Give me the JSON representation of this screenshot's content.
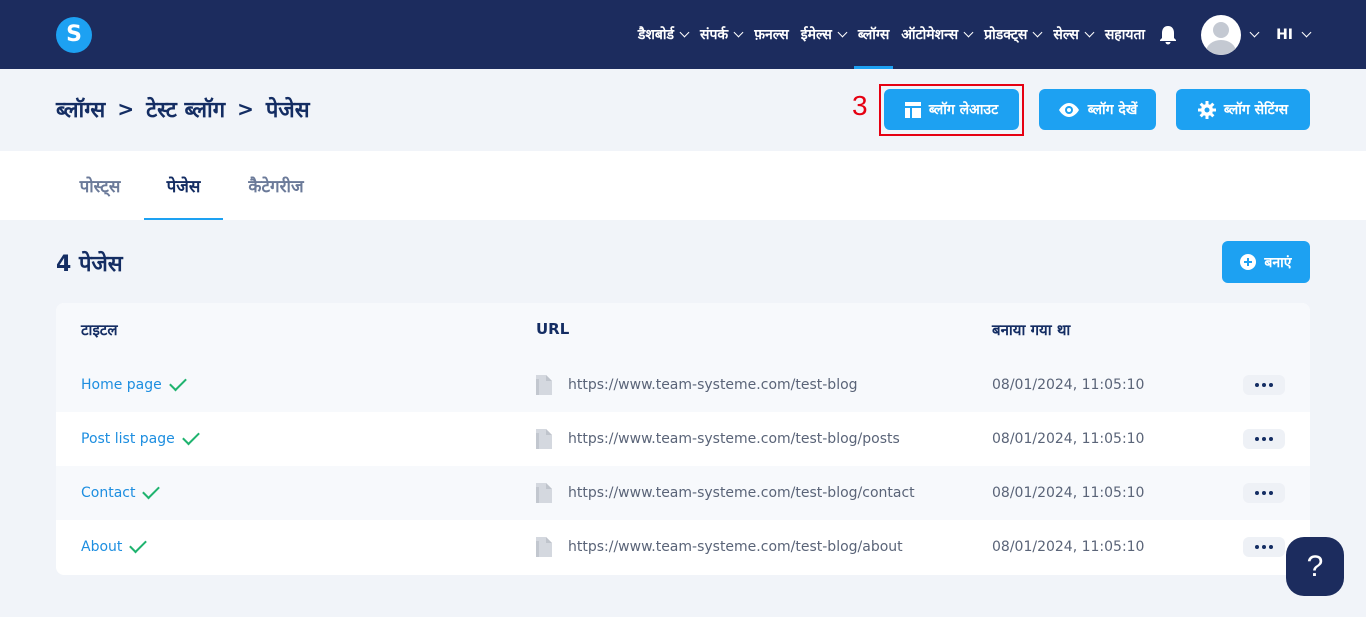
{
  "logo": {
    "letter": "S"
  },
  "nav": {
    "items": [
      {
        "label": "डैशबोर्ड",
        "dropdown": true
      },
      {
        "label": "संपर्क",
        "dropdown": true
      },
      {
        "label": "फ़नल्स",
        "dropdown": false
      },
      {
        "label": "ईमेल्स",
        "dropdown": true
      },
      {
        "label": "ब्लॉग्स",
        "dropdown": false,
        "active": true
      },
      {
        "label": "ऑटोमेशन्स",
        "dropdown": true
      },
      {
        "label": "प्रोडक्ट्स",
        "dropdown": true
      },
      {
        "label": "सेल्स",
        "dropdown": true
      },
      {
        "label": "सहायता",
        "dropdown": false
      }
    ],
    "language": "HI"
  },
  "breadcrumb": {
    "items": [
      "ब्लॉग्स",
      "टेस्ट ब्लॉग",
      "पेजेस"
    ],
    "separator": ">"
  },
  "header_buttons": {
    "layout": "ब्लॉग लेआउट",
    "view": "ब्लॉग देखें",
    "settings": "ब्लॉग सेटिंग्स"
  },
  "annotation": {
    "step": "3",
    "color": "#e60012"
  },
  "tabs": [
    {
      "label": "पोस्ट्स"
    },
    {
      "label": "पेजेस",
      "active": true
    },
    {
      "label": "कैटेगरीज"
    }
  ],
  "section": {
    "count_title": "4 पेजेस",
    "create_label": "बनाएं"
  },
  "table": {
    "headers": {
      "title": "टाइटल",
      "url": "URL",
      "created": "बनाया गया था"
    },
    "rows": [
      {
        "title": "Home page",
        "url": "https://www.team-systeme.com/test-blog",
        "created": "08/01/2024, 11:05:10"
      },
      {
        "title": "Post list page",
        "url": "https://www.team-systeme.com/test-blog/posts",
        "created": "08/01/2024, 11:05:10"
      },
      {
        "title": "Contact",
        "url": "https://www.team-systeme.com/test-blog/contact",
        "created": "08/01/2024, 11:05:10"
      },
      {
        "title": "About",
        "url": "https://www.team-systeme.com/test-blog/about",
        "created": "08/01/2024, 11:05:10"
      }
    ]
  },
  "help": {
    "label": "?"
  },
  "colors": {
    "nav_bg": "#1c2c5e",
    "accent": "#1da1f2",
    "check": "#1fb36f"
  }
}
